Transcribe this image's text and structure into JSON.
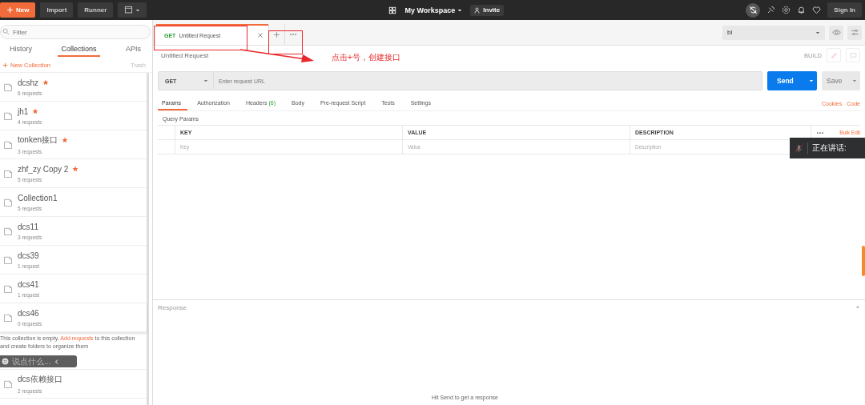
{
  "topbar": {
    "new": "New",
    "import": "Import",
    "runner": "Runner",
    "workspace": "My Workspace",
    "invite": "Invite",
    "sign_in": "Sign In"
  },
  "sidebar": {
    "filter_placeholder": "Filter",
    "tabs": [
      {
        "label": "History",
        "selected": false
      },
      {
        "label": "Collections",
        "selected": true
      },
      {
        "label": "APIs",
        "selected": false
      }
    ],
    "new_collection": "New Collection",
    "trash": "Trash",
    "collections": [
      {
        "name": "dcshz",
        "count": "6 requests",
        "starred": true
      },
      {
        "name": "jh1",
        "count": "4 requests",
        "starred": true
      },
      {
        "name": "tonken接口",
        "count": "3 requests",
        "starred": true
      },
      {
        "name": "zhf_zy Copy 2",
        "count": "5 requests",
        "starred": true
      },
      {
        "name": "Collection1",
        "count": "5 requests",
        "starred": false
      },
      {
        "name": "dcs11",
        "count": "3 requests",
        "starred": false
      },
      {
        "name": "dcs39",
        "count": "1 request",
        "starred": false
      },
      {
        "name": "dcs41",
        "count": "1 request",
        "starred": false
      },
      {
        "name": "dcs46",
        "count": "0 requests",
        "starred": false,
        "expanded": true,
        "note_before": "This collection is empty. ",
        "note_link": "Add requests",
        "note_after": " to this collection and create folders to organize them"
      },
      {
        "name": "dcs依赖接口",
        "count": "2 requests",
        "starred": false
      }
    ],
    "chat_placeholder": "说点什么..."
  },
  "request_tabs": [
    {
      "method": "GET",
      "title": "Untitled Request",
      "selected": true
    }
  ],
  "environment": "bl",
  "request": {
    "name": "Untitled Request",
    "mode": "BUILD",
    "method": "GET",
    "url_placeholder": "Enter request URL",
    "send": "Send",
    "save": "Save",
    "tabs": [
      {
        "label": "Params",
        "selected": true
      },
      {
        "label": "Authorization",
        "selected": false
      },
      {
        "label": "Headers",
        "badge": "(6)",
        "selected": false
      },
      {
        "label": "Body",
        "selected": false
      },
      {
        "label": "Pre-request Script",
        "selected": false
      },
      {
        "label": "Tests",
        "selected": false
      },
      {
        "label": "Settings",
        "selected": false
      }
    ],
    "links": [
      "Cookies",
      "Code"
    ],
    "query_params": "Query Params",
    "columns": [
      "KEY",
      "VALUE",
      "DESCRIPTION"
    ],
    "bulk_edit": "Bulk Edit",
    "placeholders": [
      "Key",
      "Value",
      "Description"
    ]
  },
  "response": {
    "title": "Response",
    "hint": "Hit Send to get a response"
  },
  "speaking": "正在讲话:",
  "annotation": "点击+号，创建接口"
}
